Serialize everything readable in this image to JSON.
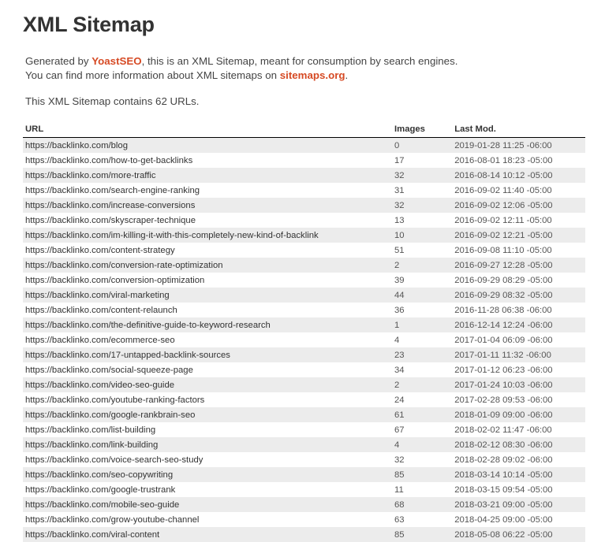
{
  "header": {
    "title": "XML Sitemap"
  },
  "description": {
    "line1_prefix": "Generated by ",
    "line1_link": "YoastSEO",
    "line1_suffix": ", this is an XML Sitemap, meant for consumption by search engines.",
    "line2_prefix": "You can find more information about XML sitemaps on ",
    "line2_link": "sitemaps.org",
    "line2_suffix": "."
  },
  "summary": "This XML Sitemap contains 62 URLs.",
  "table": {
    "columns": [
      "URL",
      "Images",
      "Last Mod."
    ],
    "rows": [
      [
        "https://backlinko.com/blog",
        "0",
        "2019-01-28 11:25 -06:00"
      ],
      [
        "https://backlinko.com/how-to-get-backlinks",
        "17",
        "2016-08-01 18:23 -05:00"
      ],
      [
        "https://backlinko.com/more-traffic",
        "32",
        "2016-08-14 10:12 -05:00"
      ],
      [
        "https://backlinko.com/search-engine-ranking",
        "31",
        "2016-09-02 11:40 -05:00"
      ],
      [
        "https://backlinko.com/increase-conversions",
        "32",
        "2016-09-02 12:06 -05:00"
      ],
      [
        "https://backlinko.com/skyscraper-technique",
        "13",
        "2016-09-02 12:11 -05:00"
      ],
      [
        "https://backlinko.com/im-killing-it-with-this-completely-new-kind-of-backlink",
        "10",
        "2016-09-02 12:21 -05:00"
      ],
      [
        "https://backlinko.com/content-strategy",
        "51",
        "2016-09-08 11:10 -05:00"
      ],
      [
        "https://backlinko.com/conversion-rate-optimization",
        "2",
        "2016-09-27 12:28 -05:00"
      ],
      [
        "https://backlinko.com/conversion-optimization",
        "39",
        "2016-09-29 08:29 -05:00"
      ],
      [
        "https://backlinko.com/viral-marketing",
        "44",
        "2016-09-29 08:32 -05:00"
      ],
      [
        "https://backlinko.com/content-relaunch",
        "36",
        "2016-11-28 06:38 -06:00"
      ],
      [
        "https://backlinko.com/the-definitive-guide-to-keyword-research",
        "1",
        "2016-12-14 12:24 -06:00"
      ],
      [
        "https://backlinko.com/ecommerce-seo",
        "4",
        "2017-01-04 06:09 -06:00"
      ],
      [
        "https://backlinko.com/17-untapped-backlink-sources",
        "23",
        "2017-01-11 11:32 -06:00"
      ],
      [
        "https://backlinko.com/social-squeeze-page",
        "34",
        "2017-01-12 06:23 -06:00"
      ],
      [
        "https://backlinko.com/video-seo-guide",
        "2",
        "2017-01-24 10:03 -06:00"
      ],
      [
        "https://backlinko.com/youtube-ranking-factors",
        "24",
        "2017-02-28 09:53 -06:00"
      ],
      [
        "https://backlinko.com/google-rankbrain-seo",
        "61",
        "2018-01-09 09:00 -06:00"
      ],
      [
        "https://backlinko.com/list-building",
        "67",
        "2018-02-02 11:47 -06:00"
      ],
      [
        "https://backlinko.com/link-building",
        "4",
        "2018-02-12 08:30 -06:00"
      ],
      [
        "https://backlinko.com/voice-search-seo-study",
        "32",
        "2018-02-28 09:02 -06:00"
      ],
      [
        "https://backlinko.com/seo-copywriting",
        "85",
        "2018-03-14 10:14 -05:00"
      ],
      [
        "https://backlinko.com/google-trustrank",
        "11",
        "2018-03-15 09:54 -05:00"
      ],
      [
        "https://backlinko.com/mobile-seo-guide",
        "68",
        "2018-03-21 09:00 -05:00"
      ],
      [
        "https://backlinko.com/grow-youtube-channel",
        "63",
        "2018-04-25 09:00 -05:00"
      ],
      [
        "https://backlinko.com/viral-content",
        "85",
        "2018-05-08 06:22 -05:00"
      ]
    ]
  },
  "colors": {
    "link": "#d64a24",
    "stripe": "#ececec",
    "text": "#333333"
  }
}
